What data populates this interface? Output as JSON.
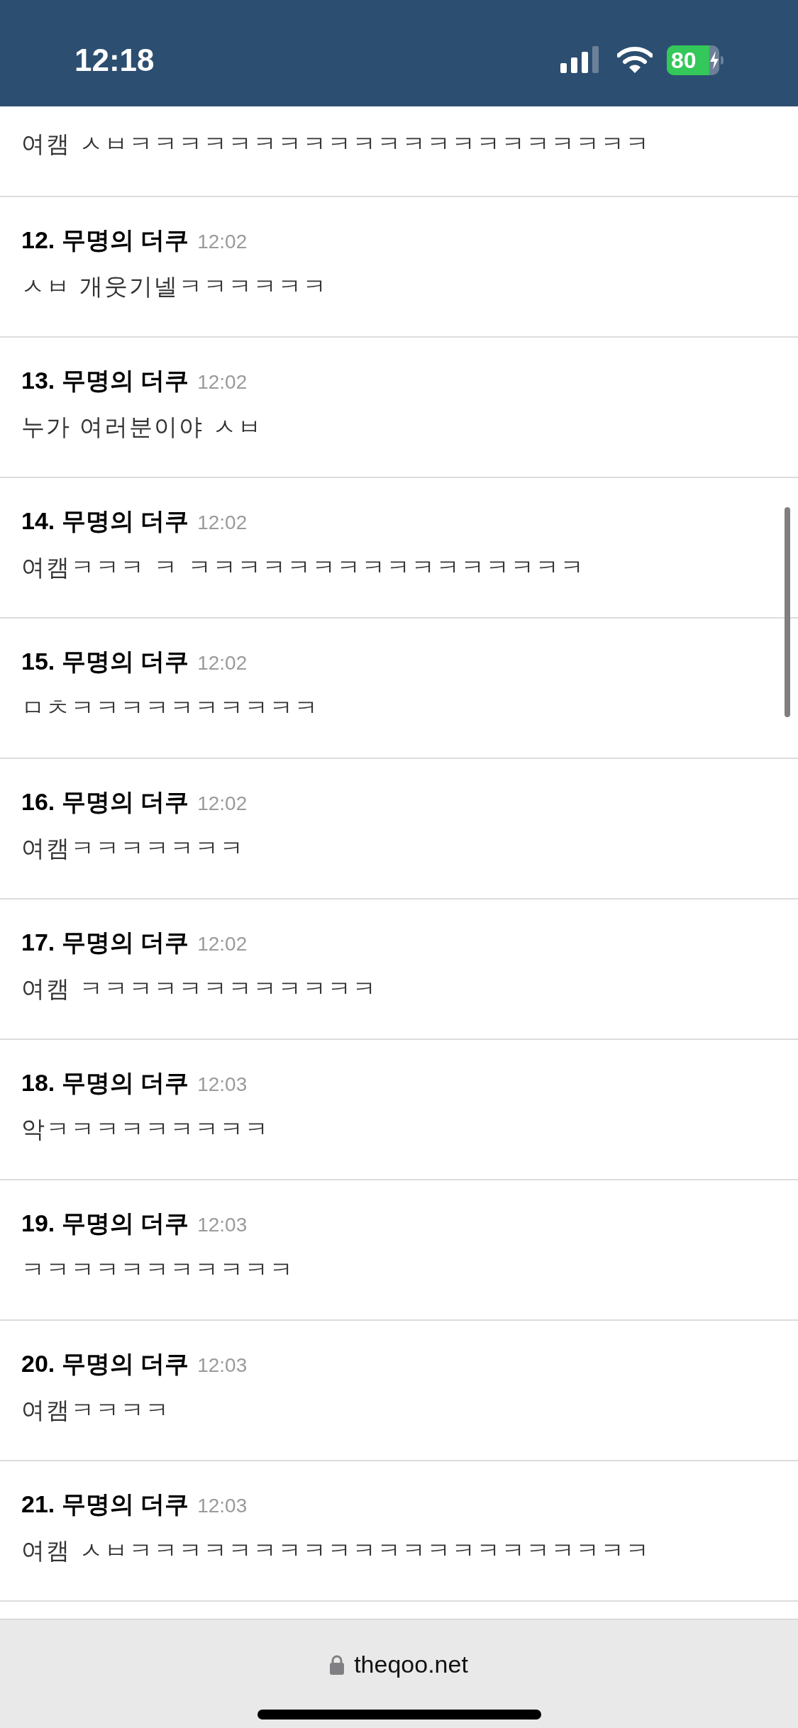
{
  "status_bar": {
    "time": "12:18",
    "battery": "80"
  },
  "comments": [
    {
      "body": "여캠 ㅅㅂㅋㅋㅋㅋㅋㅋㅋㅋㅋㅋㅋㅋㅋㅋㅋㅋㅋㅋㅋㅋㅋ"
    },
    {
      "number": "12.",
      "author": "무명의 더쿠",
      "time": "12:02",
      "body": "ㅅㅂ 개웃기넬ㅋㅋㅋㅋㅋㅋ"
    },
    {
      "number": "13.",
      "author": "무명의 더쿠",
      "time": "12:02",
      "body": "누가 여러분이야 ㅅㅂ"
    },
    {
      "number": "14.",
      "author": "무명의 더쿠",
      "time": "12:02",
      "body": "여캠ㅋㅋㅋ ㅋ ㅋㅋㅋㅋㅋㅋㅋㅋㅋㅋㅋㅋㅋㅋㅋㅋ"
    },
    {
      "number": "15.",
      "author": "무명의 더쿠",
      "time": "12:02",
      "body": "ㅁㅊㅋㅋㅋㅋㅋㅋㅋㅋㅋㅋ"
    },
    {
      "number": "16.",
      "author": "무명의 더쿠",
      "time": "12:02",
      "body": "여캠ㅋㅋㅋㅋㅋㅋㅋ"
    },
    {
      "number": "17.",
      "author": "무명의 더쿠",
      "time": "12:02",
      "body": "여캠 ㅋㅋㅋㅋㅋㅋㅋㅋㅋㅋㅋㅋ"
    },
    {
      "number": "18.",
      "author": "무명의 더쿠",
      "time": "12:03",
      "body": "악ㅋㅋㅋㅋㅋㅋㅋㅋㅋ"
    },
    {
      "number": "19.",
      "author": "무명의 더쿠",
      "time": "12:03",
      "body": "ㅋㅋㅋㅋㅋㅋㅋㅋㅋㅋㅋ"
    },
    {
      "number": "20.",
      "author": "무명의 더쿠",
      "time": "12:03",
      "body": "여캠ㅋㅋㅋㅋ"
    },
    {
      "number": "21.",
      "author": "무명의 더쿠",
      "time": "12:03",
      "body": "여캠 ㅅㅂㅋㅋㅋㅋㅋㅋㅋㅋㅋㅋㅋㅋㅋㅋㅋㅋㅋㅋㅋㅋㅋ"
    }
  ],
  "address_bar": {
    "url": "theqoo.net"
  }
}
